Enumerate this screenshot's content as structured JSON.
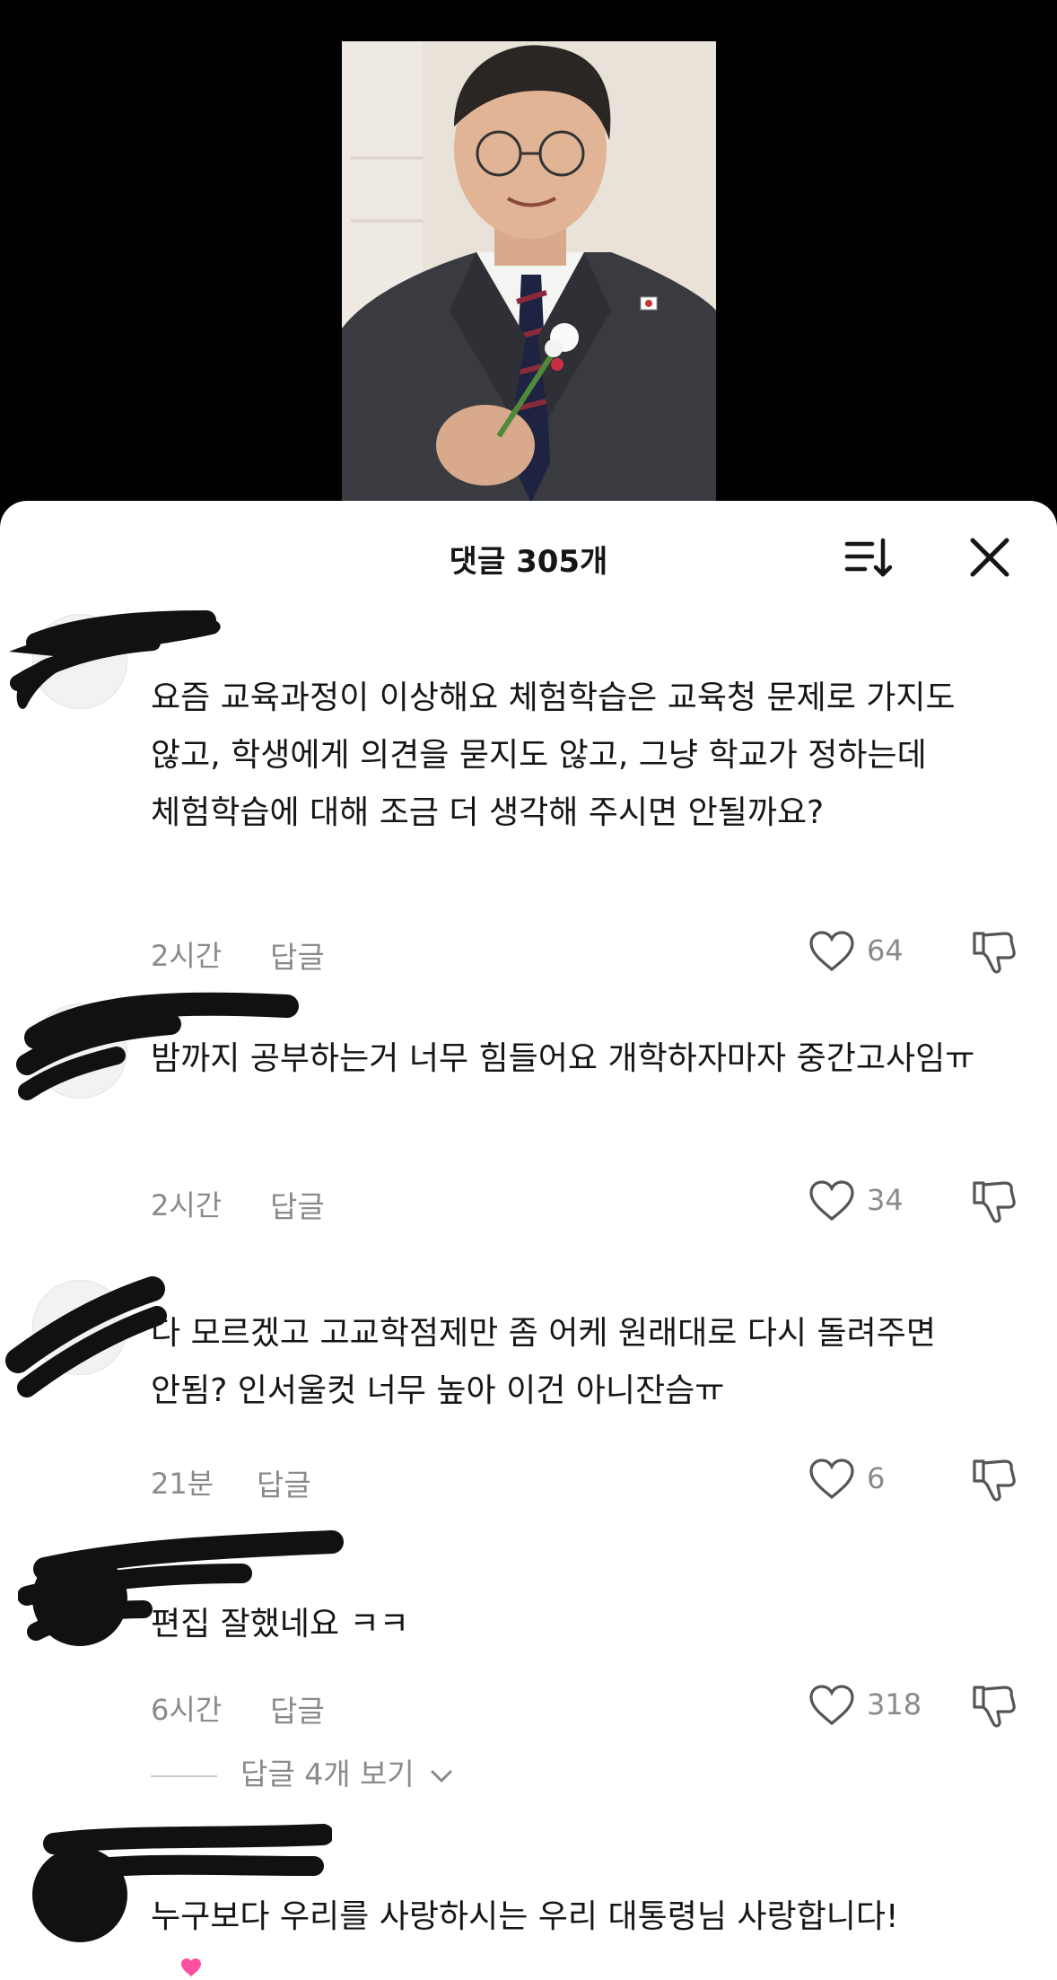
{
  "header": {
    "title": "댓글 305개",
    "sort_icon": "sort-icon",
    "close_icon": "close-icon"
  },
  "comments": [
    {
      "text": "요즘 교육과정이 이상해요 체험학습은 교육청 문제로 가지도 않고, 학생에게 의견을 묻지도 않고, 그냥 학교가 정하는데 체험학습에 대해 조금 더 생각해 주시면 안될까요?",
      "time": "2시간",
      "reply": "답글",
      "likes": "64"
    },
    {
      "text": "밤까지 공부하는거 너무 힘들어요 개학하자마자 중간고사임ㅠ",
      "time": "2시간",
      "reply": "답글",
      "likes": "34"
    },
    {
      "text": "다 모르겠고 고교학점제만 좀 어케 원래대로 다시 돌려주면 안됨? 인서울컷 너무 높아 이건 아니잔슴ㅠ",
      "time": "21분",
      "reply": "답글",
      "likes": "6"
    },
    {
      "text": "편집 잘했네요 ㅋㅋ",
      "time": "6시간",
      "reply": "답글",
      "likes": "318",
      "view_replies": "답글 4개 보기"
    },
    {
      "text": "누구보다 우리를 사랑하시는 우리 대통령님 사랑합니다!"
    }
  ],
  "colors": {
    "sheet": "#ffffff",
    "text": "#161616",
    "meta": "#8a8a8a",
    "emoji_heart": "#ff4fa3"
  }
}
